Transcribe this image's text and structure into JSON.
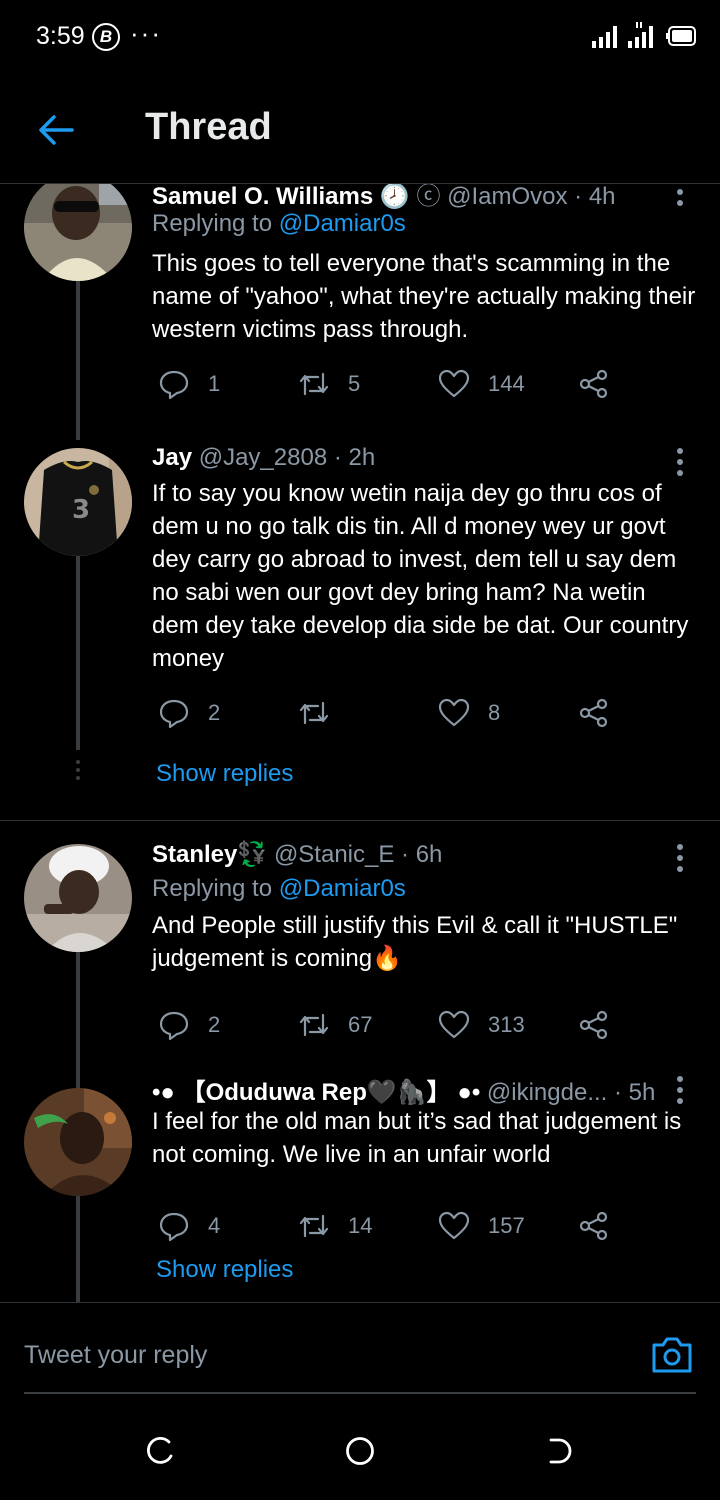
{
  "status_bar": {
    "time": "3:59",
    "b_badge": "B",
    "more": "···"
  },
  "header": {
    "title": "Thread"
  },
  "tweets": [
    {
      "name": "Samuel O. Williams",
      "meta": "ⓒ @IamOvox · 4h",
      "replying_label": "Replying to ",
      "replying_handle": "@Damiar0s",
      "text": "This goes to tell everyone that's scamming in the name of \"yahoo\", what they're actually making their western victims pass through.",
      "reply_count": "1",
      "retweet_count": "5",
      "like_count": "144"
    },
    {
      "name": "Jay",
      "meta": "@Jay_2808 · 2h",
      "text": "If to say you know wetin naija dey go thru cos of dem u no go talk dis tin. All d money wey ur govt dey carry go abroad to invest, dem tell u say dem no sabi wen our govt dey bring ham? Na wetin dem dey take develop dia side be dat. Our country money",
      "reply_count": "2",
      "retweet_count": "",
      "like_count": "8",
      "show_replies": "Show replies"
    },
    {
      "name": "Stanley",
      "name_emoji": "💱",
      "meta": "@Stanic_E · 6h",
      "replying_label": "Replying to ",
      "replying_handle": "@Damiar0s",
      "text": "And People still justify this Evil & call it \"HUSTLE\" judgement is coming🔥",
      "reply_count": "2",
      "retweet_count": "67",
      "like_count": "313"
    },
    {
      "name": "•● 【Oduduwa Rep🖤🦍】 ●•",
      "meta": "@ikingde... · 5h",
      "text": "I feel for the old man but it’s sad that judgement is not coming. We live in an unfair world",
      "reply_count": "4",
      "retweet_count": "14",
      "like_count": "157",
      "show_replies": "Show replies"
    }
  ],
  "composer": {
    "placeholder": "Tweet your reply"
  },
  "colors": {
    "accent": "#1d9bf0",
    "muted": "#8b98a5",
    "background": "#000000",
    "divider": "#2f3336"
  }
}
